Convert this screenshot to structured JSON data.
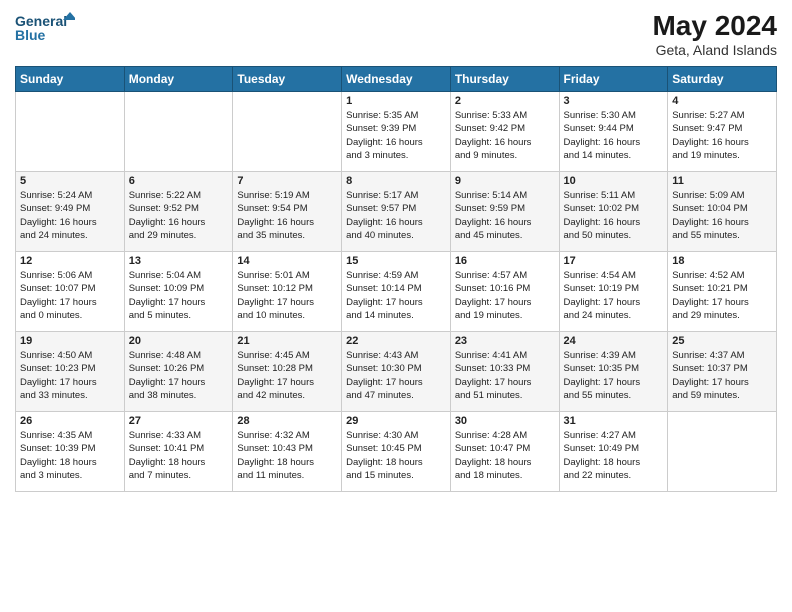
{
  "logo": {
    "text_general": "General",
    "text_blue": "Blue"
  },
  "header": {
    "month_year": "May 2024",
    "location": "Geta, Aland Islands"
  },
  "days_of_week": [
    "Sunday",
    "Monday",
    "Tuesday",
    "Wednesday",
    "Thursday",
    "Friday",
    "Saturday"
  ],
  "weeks": [
    [
      {
        "num": "",
        "info": ""
      },
      {
        "num": "",
        "info": ""
      },
      {
        "num": "",
        "info": ""
      },
      {
        "num": "1",
        "info": "Sunrise: 5:35 AM\nSunset: 9:39 PM\nDaylight: 16 hours\nand 3 minutes."
      },
      {
        "num": "2",
        "info": "Sunrise: 5:33 AM\nSunset: 9:42 PM\nDaylight: 16 hours\nand 9 minutes."
      },
      {
        "num": "3",
        "info": "Sunrise: 5:30 AM\nSunset: 9:44 PM\nDaylight: 16 hours\nand 14 minutes."
      },
      {
        "num": "4",
        "info": "Sunrise: 5:27 AM\nSunset: 9:47 PM\nDaylight: 16 hours\nand 19 minutes."
      }
    ],
    [
      {
        "num": "5",
        "info": "Sunrise: 5:24 AM\nSunset: 9:49 PM\nDaylight: 16 hours\nand 24 minutes."
      },
      {
        "num": "6",
        "info": "Sunrise: 5:22 AM\nSunset: 9:52 PM\nDaylight: 16 hours\nand 29 minutes."
      },
      {
        "num": "7",
        "info": "Sunrise: 5:19 AM\nSunset: 9:54 PM\nDaylight: 16 hours\nand 35 minutes."
      },
      {
        "num": "8",
        "info": "Sunrise: 5:17 AM\nSunset: 9:57 PM\nDaylight: 16 hours\nand 40 minutes."
      },
      {
        "num": "9",
        "info": "Sunrise: 5:14 AM\nSunset: 9:59 PM\nDaylight: 16 hours\nand 45 minutes."
      },
      {
        "num": "10",
        "info": "Sunrise: 5:11 AM\nSunset: 10:02 PM\nDaylight: 16 hours\nand 50 minutes."
      },
      {
        "num": "11",
        "info": "Sunrise: 5:09 AM\nSunset: 10:04 PM\nDaylight: 16 hours\nand 55 minutes."
      }
    ],
    [
      {
        "num": "12",
        "info": "Sunrise: 5:06 AM\nSunset: 10:07 PM\nDaylight: 17 hours\nand 0 minutes."
      },
      {
        "num": "13",
        "info": "Sunrise: 5:04 AM\nSunset: 10:09 PM\nDaylight: 17 hours\nand 5 minutes."
      },
      {
        "num": "14",
        "info": "Sunrise: 5:01 AM\nSunset: 10:12 PM\nDaylight: 17 hours\nand 10 minutes."
      },
      {
        "num": "15",
        "info": "Sunrise: 4:59 AM\nSunset: 10:14 PM\nDaylight: 17 hours\nand 14 minutes."
      },
      {
        "num": "16",
        "info": "Sunrise: 4:57 AM\nSunset: 10:16 PM\nDaylight: 17 hours\nand 19 minutes."
      },
      {
        "num": "17",
        "info": "Sunrise: 4:54 AM\nSunset: 10:19 PM\nDaylight: 17 hours\nand 24 minutes."
      },
      {
        "num": "18",
        "info": "Sunrise: 4:52 AM\nSunset: 10:21 PM\nDaylight: 17 hours\nand 29 minutes."
      }
    ],
    [
      {
        "num": "19",
        "info": "Sunrise: 4:50 AM\nSunset: 10:23 PM\nDaylight: 17 hours\nand 33 minutes."
      },
      {
        "num": "20",
        "info": "Sunrise: 4:48 AM\nSunset: 10:26 PM\nDaylight: 17 hours\nand 38 minutes."
      },
      {
        "num": "21",
        "info": "Sunrise: 4:45 AM\nSunset: 10:28 PM\nDaylight: 17 hours\nand 42 minutes."
      },
      {
        "num": "22",
        "info": "Sunrise: 4:43 AM\nSunset: 10:30 PM\nDaylight: 17 hours\nand 47 minutes."
      },
      {
        "num": "23",
        "info": "Sunrise: 4:41 AM\nSunset: 10:33 PM\nDaylight: 17 hours\nand 51 minutes."
      },
      {
        "num": "24",
        "info": "Sunrise: 4:39 AM\nSunset: 10:35 PM\nDaylight: 17 hours\nand 55 minutes."
      },
      {
        "num": "25",
        "info": "Sunrise: 4:37 AM\nSunset: 10:37 PM\nDaylight: 17 hours\nand 59 minutes."
      }
    ],
    [
      {
        "num": "26",
        "info": "Sunrise: 4:35 AM\nSunset: 10:39 PM\nDaylight: 18 hours\nand 3 minutes."
      },
      {
        "num": "27",
        "info": "Sunrise: 4:33 AM\nSunset: 10:41 PM\nDaylight: 18 hours\nand 7 minutes."
      },
      {
        "num": "28",
        "info": "Sunrise: 4:32 AM\nSunset: 10:43 PM\nDaylight: 18 hours\nand 11 minutes."
      },
      {
        "num": "29",
        "info": "Sunrise: 4:30 AM\nSunset: 10:45 PM\nDaylight: 18 hours\nand 15 minutes."
      },
      {
        "num": "30",
        "info": "Sunrise: 4:28 AM\nSunset: 10:47 PM\nDaylight: 18 hours\nand 18 minutes."
      },
      {
        "num": "31",
        "info": "Sunrise: 4:27 AM\nSunset: 10:49 PM\nDaylight: 18 hours\nand 22 minutes."
      },
      {
        "num": "",
        "info": ""
      }
    ]
  ]
}
